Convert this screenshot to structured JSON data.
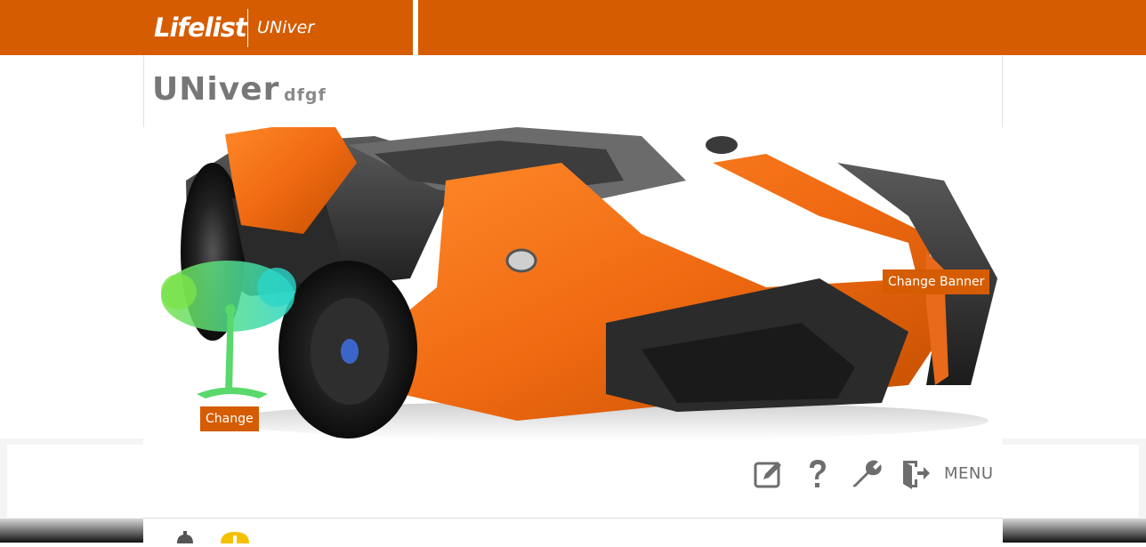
{
  "header": {
    "logo_text": "Lifelist",
    "site_name": "UNiver"
  },
  "profile": {
    "title": "UNiver",
    "subtitle": "dfgf"
  },
  "banner": {
    "change_banner_label": "Change Banner",
    "change_avatar_label": "Change",
    "image_subject": "orange-sports-car",
    "avatar_subject": "tree-yoga-figure"
  },
  "toolbar": {
    "icons": [
      "edit-icon",
      "help-icon",
      "settings-wrench-icon",
      "logout-icon"
    ],
    "menu_label": "MENU"
  },
  "colors": {
    "brand": "#d55c00",
    "icon_gray": "#6d6d6d"
  }
}
